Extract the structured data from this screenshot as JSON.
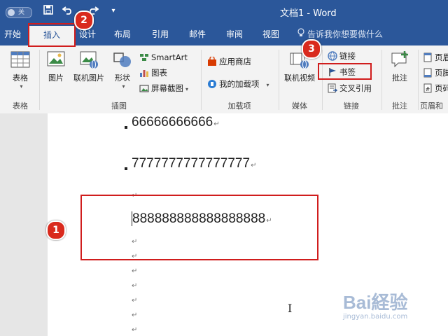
{
  "title_bar": {
    "autosave_label": "关",
    "doc_title": "文档1 - Word",
    "qa_save": "save-icon",
    "qa_undo": "undo-icon",
    "qa_redo": "redo-icon"
  },
  "tabs": [
    "开始",
    "插入",
    "设计",
    "布局",
    "引用",
    "邮件",
    "审阅",
    "视图"
  ],
  "tell_me": "告诉我你想要做什么",
  "ribbon": {
    "groups": {
      "tables": "表格",
      "illustrations": "插图",
      "addins": "加载项",
      "media": "媒体",
      "links": "链接",
      "comments": "批注",
      "header_footer": "页眉和"
    },
    "table_btn": "表格",
    "pictures_btn": "图片",
    "online_pictures_btn": "联机图片",
    "shapes_btn": "形状",
    "smartart_btn": "SmartArt",
    "chart_btn": "图表",
    "screenshot_btn": "屏幕截图",
    "store_btn": "应用商店",
    "my_addins_btn": "我的加载项",
    "online_video_btn": "联机视频",
    "link_btn": "链接",
    "bookmark_btn": "书签",
    "crossref_btn": "交叉引用",
    "comment_btn": "批注",
    "header_btn": "页眉",
    "footer_btn": "页脚",
    "pagenum_btn": "页码"
  },
  "document": {
    "line1": "66666666666",
    "line2": "7777777777777777",
    "line3": "888888888888888888",
    "pilcrow": "↵"
  },
  "annotations": {
    "step1": "1",
    "step2": "2",
    "step3": "3"
  },
  "watermark": {
    "brand": "Bai経验",
    "url": "jingyan.baidu.com"
  },
  "colors": {
    "word_blue": "#2b579a",
    "annotation_red": "#d01d1d"
  }
}
